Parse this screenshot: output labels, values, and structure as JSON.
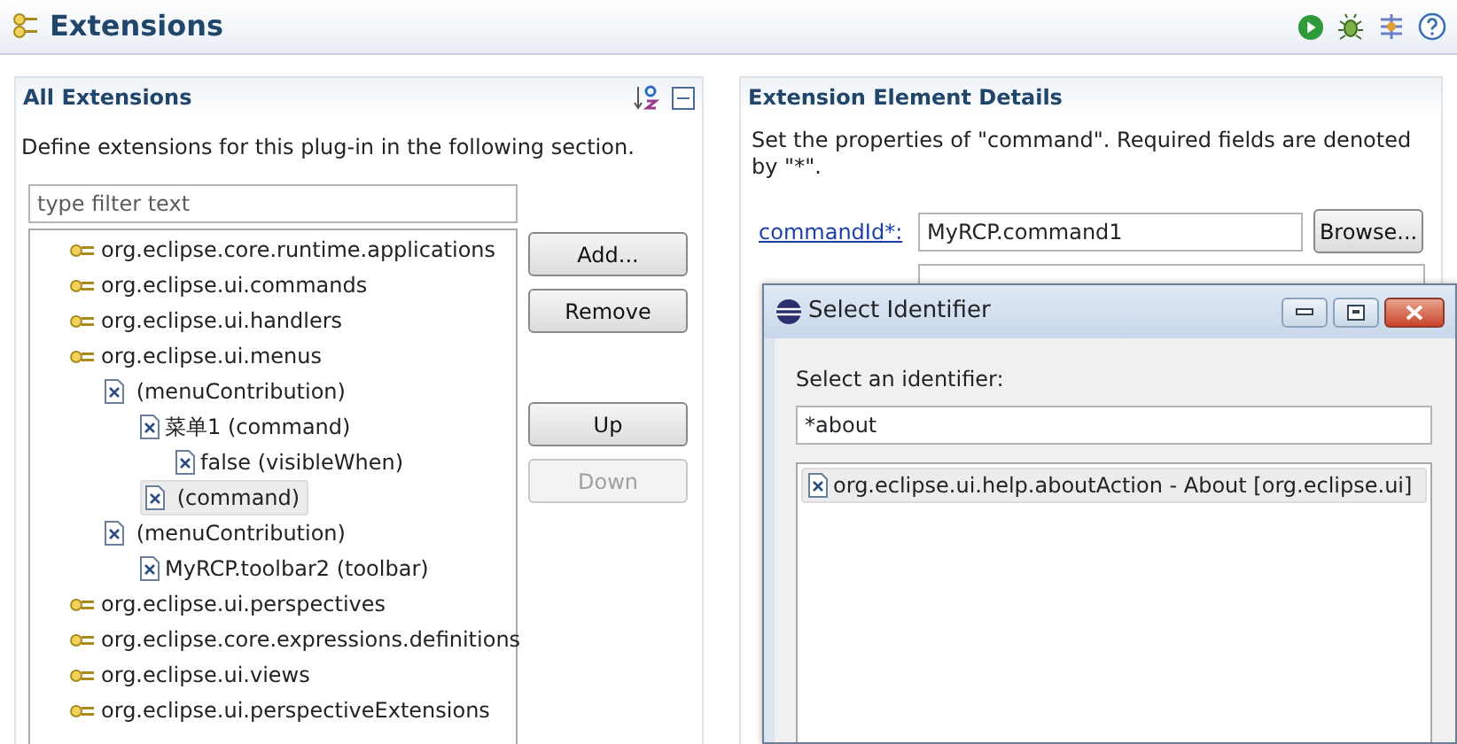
{
  "editor": {
    "title": "Extensions"
  },
  "all_extensions": {
    "title": "All Extensions",
    "description": "Define extensions for this plug-in in the following section.",
    "filter": {
      "placeholder": "type filter text"
    },
    "tree": [
      {
        "kind": "extension",
        "label": "org.eclipse.core.runtime.applications",
        "selected": false
      },
      {
        "kind": "extension",
        "label": "org.eclipse.ui.commands",
        "selected": false
      },
      {
        "kind": "extension",
        "label": "org.eclipse.ui.handlers",
        "selected": false
      },
      {
        "kind": "extension",
        "label": "org.eclipse.ui.menus",
        "selected": false,
        "children": [
          {
            "kind": "element",
            "label": " (menuContribution)",
            "selected": false,
            "children": [
              {
                "kind": "element",
                "label": "菜单1 (command)",
                "selected": false,
                "children": [
                  {
                    "kind": "element",
                    "label": "false (visibleWhen)",
                    "selected": false
                  }
                ]
              },
              {
                "kind": "element",
                "label": " (command)",
                "selected": true
              }
            ]
          },
          {
            "kind": "element",
            "label": " (menuContribution)",
            "selected": false,
            "children": [
              {
                "kind": "element",
                "label": "MyRCP.toolbar2 (toolbar)",
                "selected": false
              }
            ]
          }
        ]
      },
      {
        "kind": "extension",
        "label": "org.eclipse.ui.perspectives",
        "selected": false
      },
      {
        "kind": "extension",
        "label": "org.eclipse.core.expressions.definitions",
        "selected": false
      },
      {
        "kind": "extension",
        "label": "org.eclipse.ui.views",
        "selected": false
      },
      {
        "kind": "extension",
        "label": "org.eclipse.ui.perspectiveExtensions",
        "selected": false
      }
    ],
    "buttons": [
      {
        "label": "Add...",
        "disabled": false
      },
      {
        "label": "Remove",
        "disabled": false
      },
      {
        "label": "Up",
        "disabled": false
      },
      {
        "label": "Down",
        "disabled": true
      }
    ]
  },
  "details": {
    "title": "Extension Element Details",
    "description": "Set the properties of \"command\". Required fields are denoted by \"*\".",
    "fields": [
      {
        "label": "commandId*:",
        "value": "MyRCP.command1",
        "button": "Browse..."
      }
    ]
  },
  "dialog": {
    "title": "Select Identifier",
    "prompt": "Select an identifier:",
    "filter_value": "*about",
    "items": [
      {
        "label": "org.eclipse.ui.help.aboutAction - About [org.eclipse.ui]",
        "selected": true
      }
    ]
  }
}
